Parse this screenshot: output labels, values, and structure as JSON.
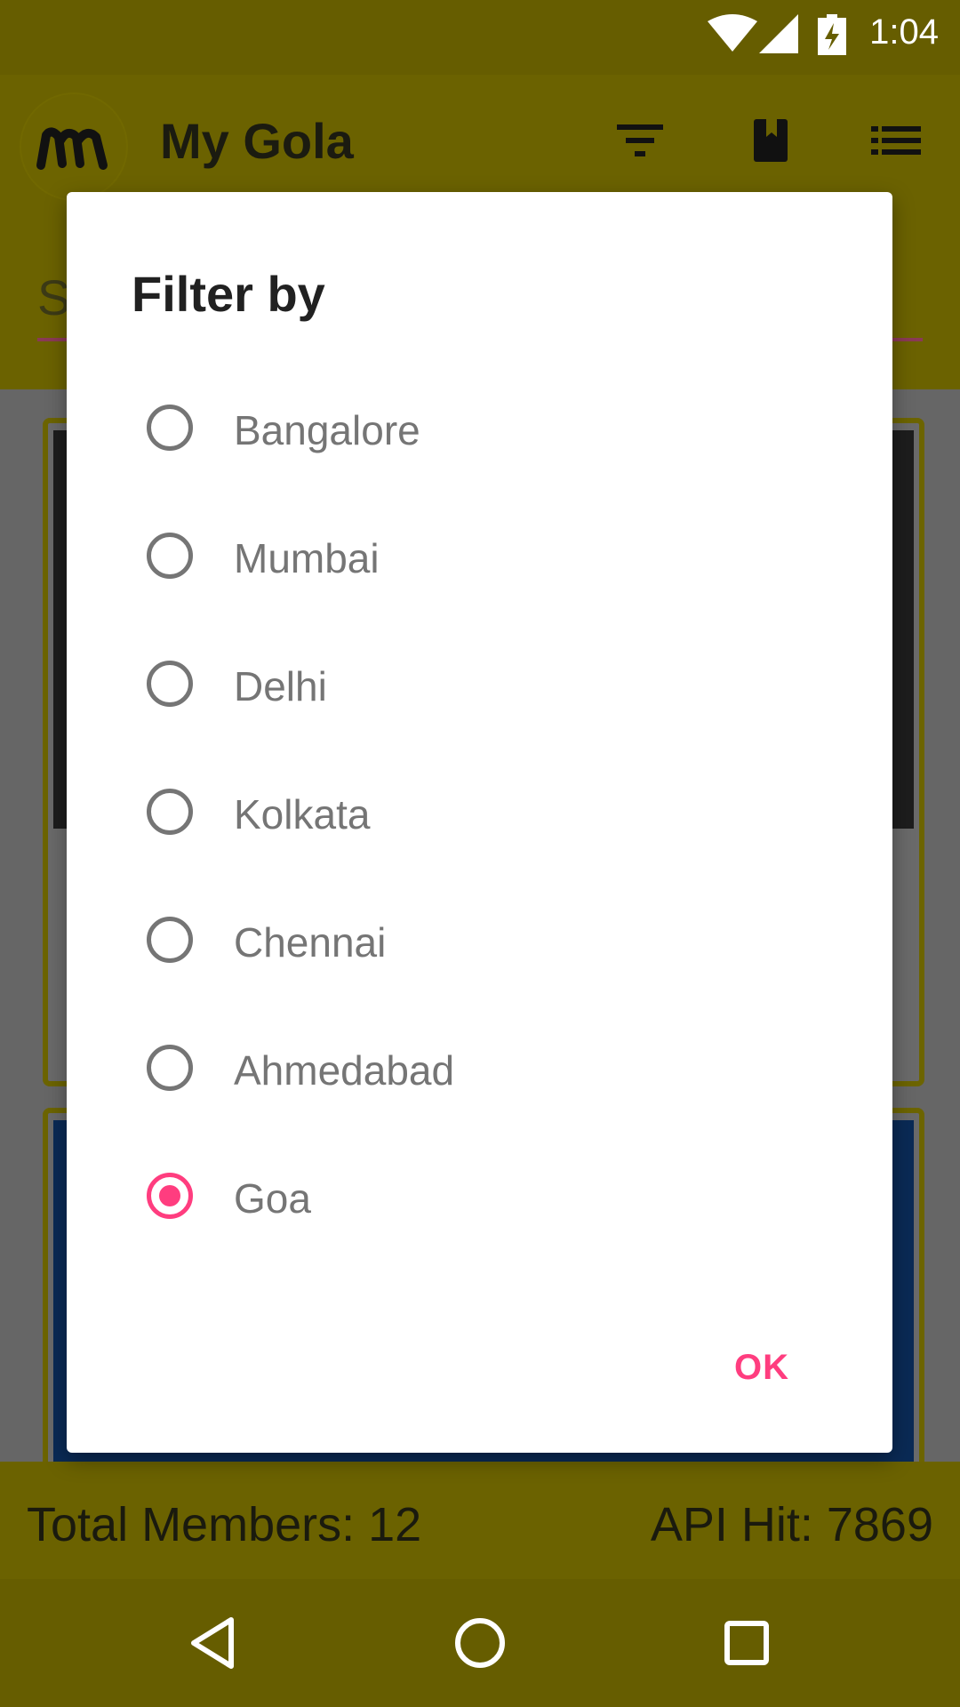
{
  "status_bar": {
    "time": "1:04"
  },
  "app_bar": {
    "title": "My Gola",
    "actions": [
      "filter-icon",
      "book-icon",
      "list-icon"
    ]
  },
  "search": {
    "text": "S"
  },
  "stats": {
    "total_members": "Total Members: 12",
    "api_hit": "API Hit: 7869"
  },
  "dialog": {
    "title": "Filter by",
    "options": [
      {
        "label": "Bangalore",
        "checked": false
      },
      {
        "label": "Mumbai",
        "checked": false
      },
      {
        "label": "Delhi",
        "checked": false
      },
      {
        "label": "Kolkata",
        "checked": false
      },
      {
        "label": "Chennai",
        "checked": false
      },
      {
        "label": "Ahmedabad",
        "checked": false
      },
      {
        "label": "Goa",
        "checked": true
      }
    ],
    "ok_label": "OK"
  },
  "colors": {
    "accent": "#ff3d7f",
    "app_bar_dimmed": "#6b6200"
  },
  "nav_bar": [
    "back-icon",
    "home-icon",
    "recents-icon"
  ]
}
